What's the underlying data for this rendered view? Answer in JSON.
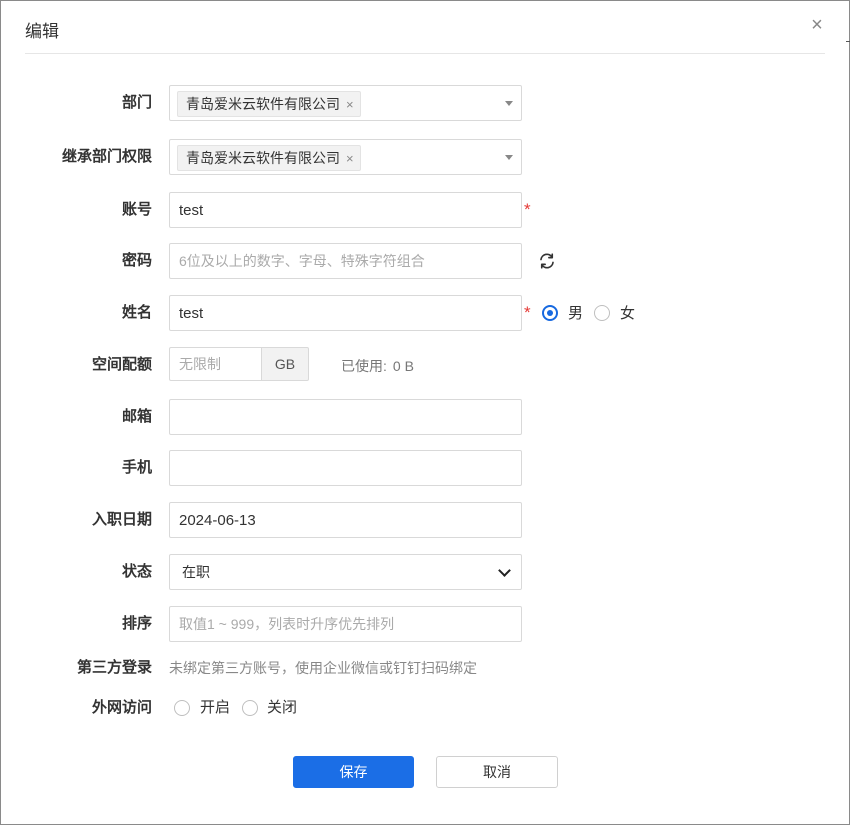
{
  "dialog": {
    "title": "编辑",
    "close_label": "×"
  },
  "form": {
    "department": {
      "label": "部门",
      "tag": "青岛爱米云软件有限公司",
      "tag_remove": "×"
    },
    "inherit_permission": {
      "label": "继承部门权限",
      "tag": "青岛爱米云软件有限公司",
      "tag_remove": "×"
    },
    "account": {
      "label": "账号",
      "value": "test",
      "required_mark": "*"
    },
    "password": {
      "label": "密码",
      "placeholder": "6位及以上的数字、字母、特殊字符组合",
      "value": ""
    },
    "name": {
      "label": "姓名",
      "value": "test",
      "required_mark": "*"
    },
    "gender": {
      "options": [
        "男",
        "女"
      ],
      "selected": "男"
    },
    "quota": {
      "label": "空间配额",
      "placeholder": "无限制",
      "unit": "GB",
      "used_label": "已使用:",
      "used_value": "0 B"
    },
    "email": {
      "label": "邮箱",
      "value": ""
    },
    "phone": {
      "label": "手机",
      "value": ""
    },
    "hire_date": {
      "label": "入职日期",
      "value": "2024-06-13"
    },
    "status": {
      "label": "状态",
      "value": "在职"
    },
    "sort": {
      "label": "排序",
      "placeholder": "取值1 ~ 999，列表时升序优先排列",
      "value": ""
    },
    "third_party": {
      "label": "第三方登录",
      "hint": "未绑定第三方账号，使用企业微信或钉钉扫码绑定"
    },
    "external_access": {
      "label": "外网访问",
      "options": [
        "开启",
        "关闭"
      ],
      "selected": ""
    }
  },
  "buttons": {
    "save": "保存",
    "cancel": "取消"
  },
  "colors": {
    "primary": "#1b6ee6",
    "required": "#e53935",
    "radio_checked": "#1769e0"
  },
  "icons": {
    "refresh": "refresh-icon",
    "close": "close-icon",
    "dropdown": "caret-down-icon"
  }
}
